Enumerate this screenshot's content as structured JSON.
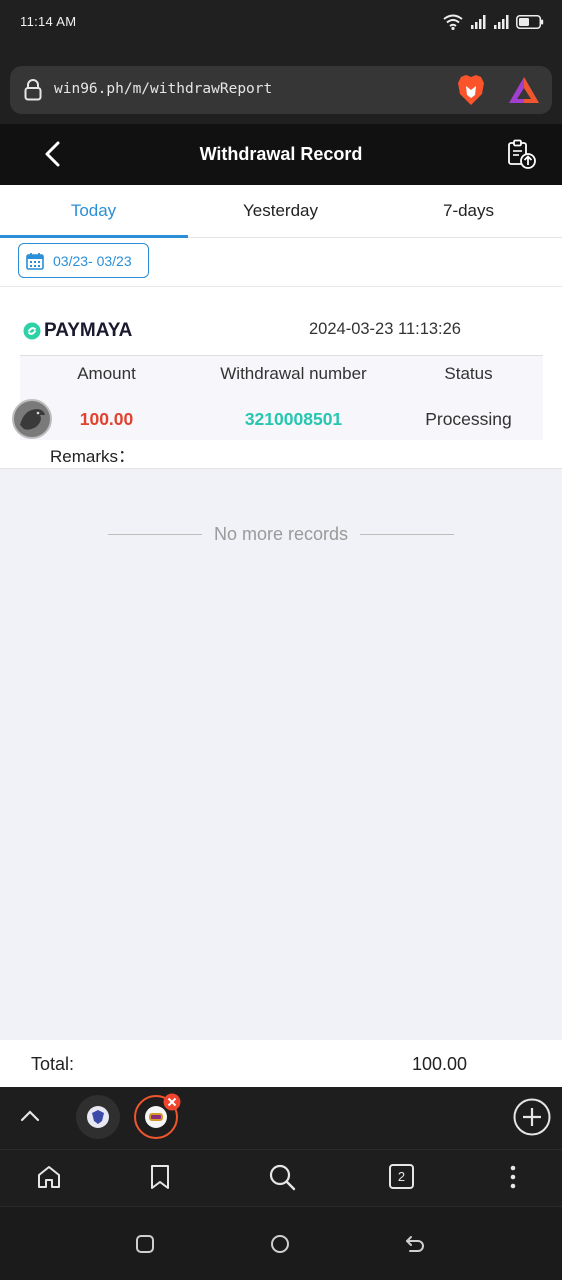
{
  "status_bar": {
    "time": "11:14 AM",
    "battery": ""
  },
  "browser": {
    "url": "win96.ph/m/withdrawReport",
    "tab_count": "2"
  },
  "header": {
    "title": "Withdrawal Record"
  },
  "tabs": [
    {
      "label": "Today",
      "active": true
    },
    {
      "label": "Yesterday",
      "active": false
    },
    {
      "label": "7-days",
      "active": false
    }
  ],
  "date_filter": {
    "range": "03/23- 03/23"
  },
  "record": {
    "provider": "PAYMAYA",
    "datetime": "2024-03-23 11:13:26",
    "columns": {
      "amount": "Amount",
      "number": "Withdrawal number",
      "status": "Status"
    },
    "amount": "100.00",
    "withdrawal_number": "3210008501",
    "status": "Processing",
    "remarks_label": "Remarks："
  },
  "no_more": "No more records",
  "total": {
    "label": "Total:",
    "value": "100.00"
  },
  "colors": {
    "accent": "#2a8fd6",
    "amount": "#e0432f",
    "number": "#26c6b0",
    "header_bg": "#111111"
  }
}
